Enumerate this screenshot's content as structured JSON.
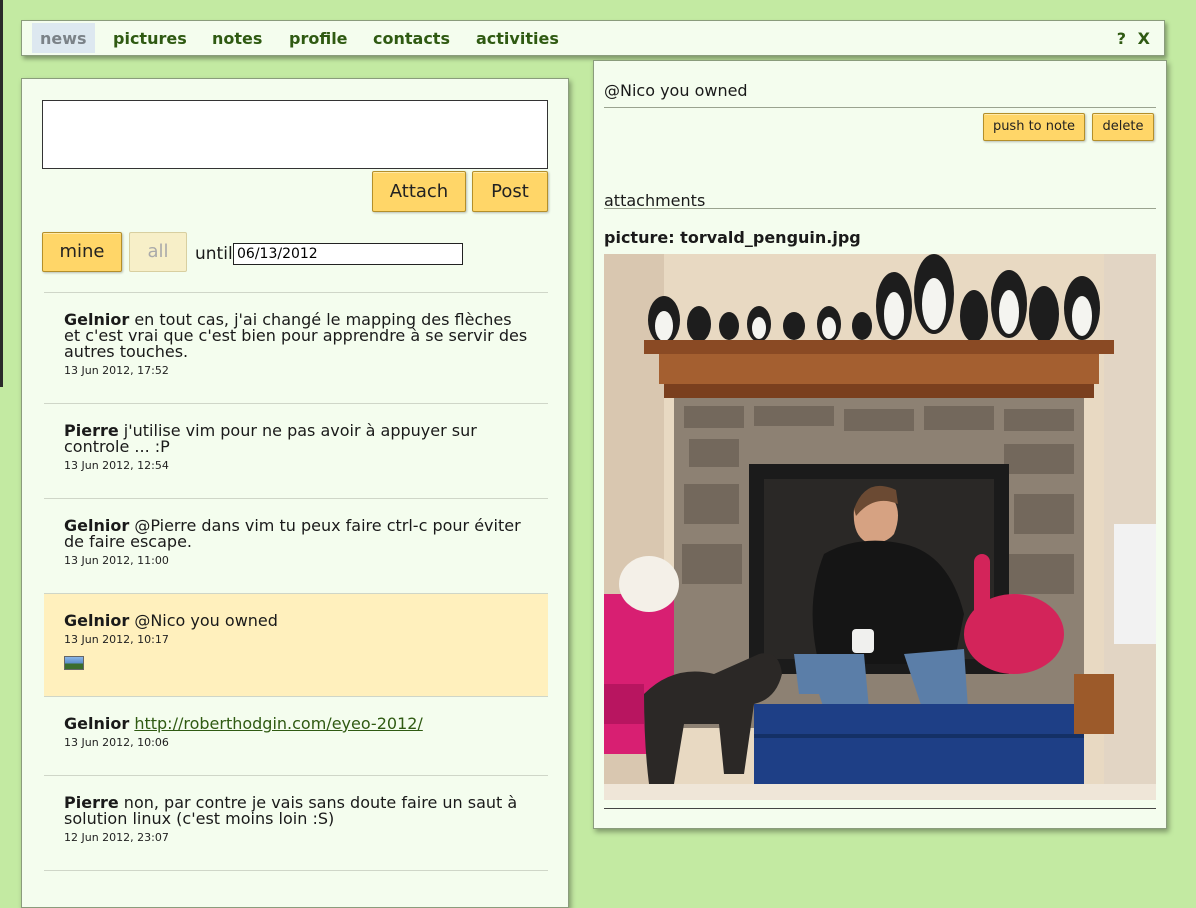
{
  "nav": {
    "items": [
      {
        "label": "news",
        "active": true
      },
      {
        "label": "pictures",
        "active": false
      },
      {
        "label": "notes",
        "active": false
      },
      {
        "label": "profile",
        "active": false
      },
      {
        "label": "contacts",
        "active": false
      },
      {
        "label": "activities",
        "active": false
      }
    ],
    "help_label": "?",
    "close_label": "X"
  },
  "composer": {
    "value": "",
    "attach_label": "Attach",
    "post_label": "Post"
  },
  "filter": {
    "mine_label": "mine",
    "all_label": "all",
    "until_label": "until",
    "date_value": "06/13/2012"
  },
  "feed": [
    {
      "author": "Gelnior",
      "text": "en tout cas, j'ai changé le mapping des flèches et c'est vrai que c'est bien pour apprendre à se servir des autres touches.",
      "time": "13 Jun 2012, 17:52"
    },
    {
      "author": "Pierre",
      "text": "j'utilise vim pour ne pas avoir à appuyer sur controle ... :P",
      "time": "13 Jun 2012, 12:54"
    },
    {
      "author": "Gelnior",
      "text": "@Pierre dans vim tu peux faire ctrl-c pour éviter de faire escape.",
      "time": "13 Jun 2012, 11:00"
    },
    {
      "author": "Gelnior",
      "text": "@Nico you owned",
      "time": "13 Jun 2012, 10:17",
      "highlighted": true,
      "attachment_icon": "image-icon"
    },
    {
      "author": "Gelnior",
      "link": "http://roberthodgin.com/eyeo-2012/",
      "time": "13 Jun 2012, 10:06"
    },
    {
      "author": "Pierre",
      "text": "non, par contre je vais sans doute faire un saut à solution linux (c'est moins loin :S)",
      "time": "12 Jun 2012, 23:07"
    }
  ],
  "detail": {
    "title": "@Nico you owned",
    "push_label": "push to note",
    "delete_label": "delete",
    "attachments_heading": "attachments",
    "picture_title": "picture: torvald_penguin.jpg"
  },
  "colors": {
    "background": "#c3eaa2",
    "panel": "#f4fdee",
    "button": "#ffd668",
    "nav_text": "#2f5a12",
    "highlight": "#fff0bd"
  }
}
